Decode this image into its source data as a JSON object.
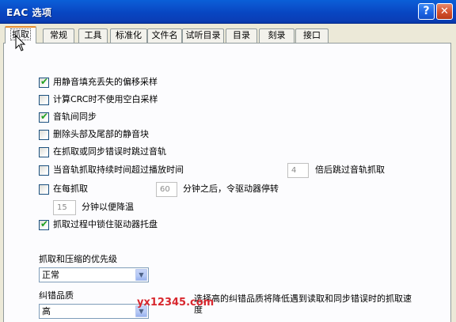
{
  "window": {
    "title": "EAC 选项"
  },
  "titlebar": {
    "help_label": "?",
    "close_label": "✕"
  },
  "tabs": [
    {
      "label": "抓取",
      "active": true
    },
    {
      "label": "常规",
      "active": false
    },
    {
      "label": "工具",
      "active": false
    },
    {
      "label": "标准化",
      "active": false
    },
    {
      "label": "文件名",
      "active": false
    },
    {
      "label": "试听目录",
      "active": false
    },
    {
      "label": "目录",
      "active": false
    },
    {
      "label": "刻录",
      "active": false
    },
    {
      "label": "接口",
      "active": false
    }
  ],
  "options": [
    {
      "label": "用静音填充丢失的偏移采样",
      "checked": true
    },
    {
      "label": "计算CRC时不使用空白采样",
      "checked": false
    },
    {
      "label": "音轨间同步",
      "checked": true
    },
    {
      "label": "删除头部及尾部的静音块",
      "checked": false
    },
    {
      "label": "在抓取或同步错误时跳过音轨",
      "checked": false
    },
    {
      "label": "当音轨抓取持续时间超过播放时间",
      "checked": false,
      "value": "4",
      "suffix": "倍后跳过音轨抓取"
    },
    {
      "label": "在每抓取",
      "checked": false,
      "value": "60",
      "suffix": "分钟之后，令驱动器停转"
    },
    {
      "label": "抓取过程中锁住驱动器托盘",
      "checked": true
    }
  ],
  "cooldown": {
    "value": "15",
    "suffix": "分钟以便降温"
  },
  "priority": {
    "label": "抓取和压缩的优先级",
    "value": "正常"
  },
  "quality": {
    "label": "纠错品质",
    "value": "高",
    "note_line1": "选择高的纠错品质将降低遇到读取和同步错误时的抓取速",
    "note_line2": "度"
  },
  "watermark": "yx12345.com",
  "icons": {
    "checkmark": "✔",
    "dropdown": "▼"
  },
  "colors": {
    "titlebar": "#0846c2",
    "active_tab_accent": "#e68b2c",
    "check": "#21a121",
    "watermark": "#d8272e"
  }
}
